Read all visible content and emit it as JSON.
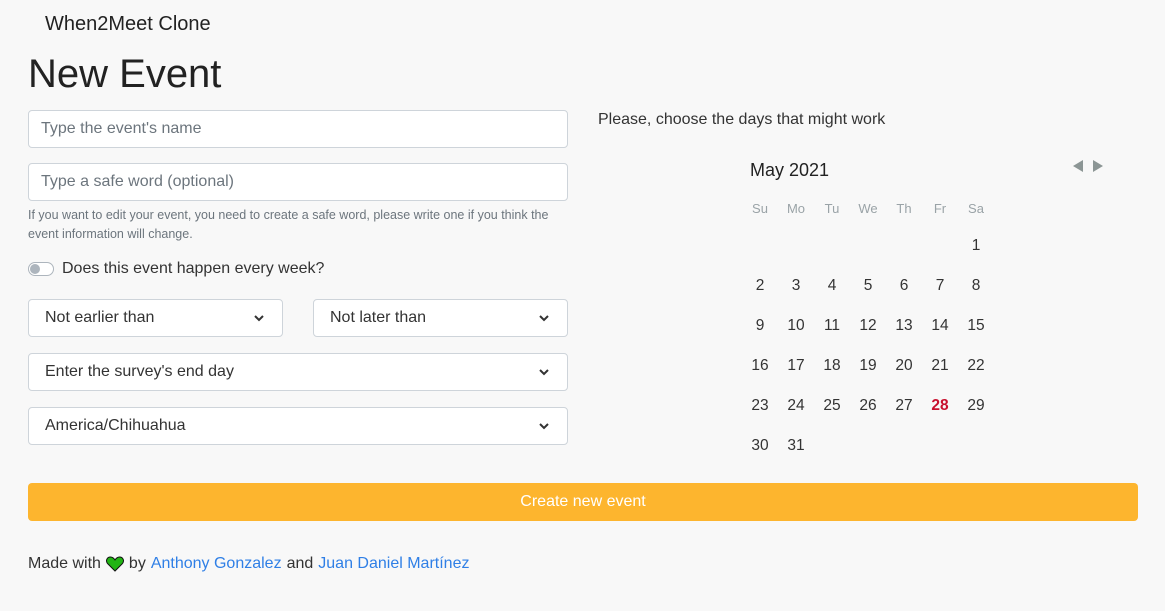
{
  "header": {
    "brand": "When2Meet Clone",
    "title": "New Event"
  },
  "form": {
    "event_name_placeholder": "Type the event's name",
    "safe_word_placeholder": "Type a safe word (optional)",
    "safe_word_help": "If you want to edit your event, you need to create a safe word, please write one if you think the event information will change.",
    "weekly_toggle_label": "Does this event happen every week?",
    "weekly_toggle_on": false,
    "not_earlier_than": "Not earlier than",
    "not_later_than": "Not later than",
    "survey_end_day": "Enter the survey's end day",
    "timezone": "America/Chihuahua",
    "create_button": "Create new event"
  },
  "calendar": {
    "prompt": "Please, choose the days that might work",
    "month_label": "May 2021",
    "weekdays": [
      "Su",
      "Mo",
      "Tu",
      "We",
      "Th",
      "Fr",
      "Sa"
    ],
    "first_weekday_index": 6,
    "days_in_month": 31,
    "today": 28,
    "today_color": "#c8102e"
  },
  "footer": {
    "made_with": "Made with",
    "by": "by",
    "author1": "Anthony Gonzalez",
    "and": "and",
    "author2": "Juan Daniel Martínez"
  },
  "colors": {
    "accent": "#fdb52e",
    "link": "#2f7fe6",
    "heart": "#22b514"
  }
}
